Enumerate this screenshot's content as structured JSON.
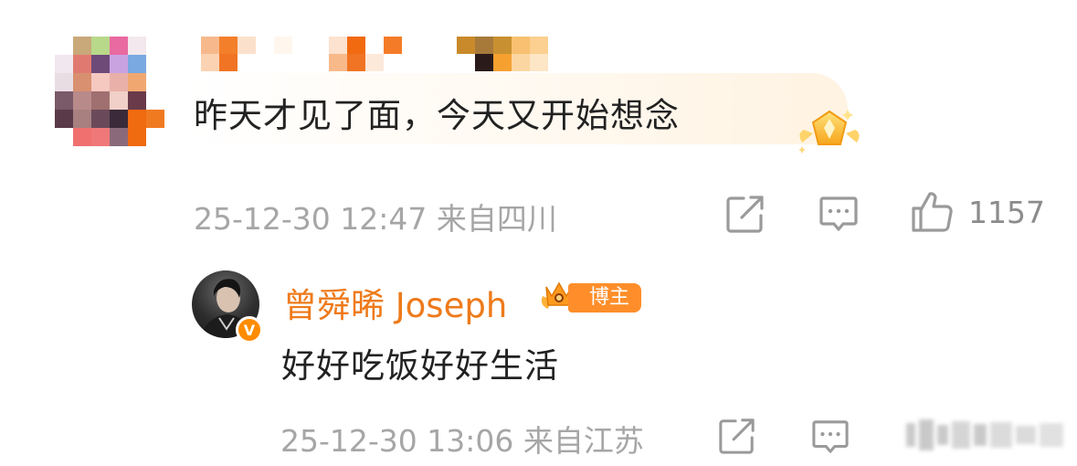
{
  "comments": [
    {
      "text": "昨天才见了面，今天又开始想念",
      "timestamp": "25-12-30 12:47",
      "location": "来自四川",
      "like_count": "1157",
      "badge_icon": "crown-medal-icon"
    }
  ],
  "reply": {
    "author": "曾舜晞 Joseph",
    "author_tag": "博主",
    "verified_badge": "V",
    "text": "好好吃饭好好生活",
    "timestamp": "25-12-30 13:06",
    "location": "来自江苏"
  },
  "colors": {
    "accent_orange": "#ee7a1a",
    "meta_gray": "#a6a6a6",
    "text_dark": "#222222"
  },
  "actions": [
    "share-icon",
    "comment-icon",
    "like-icon"
  ]
}
